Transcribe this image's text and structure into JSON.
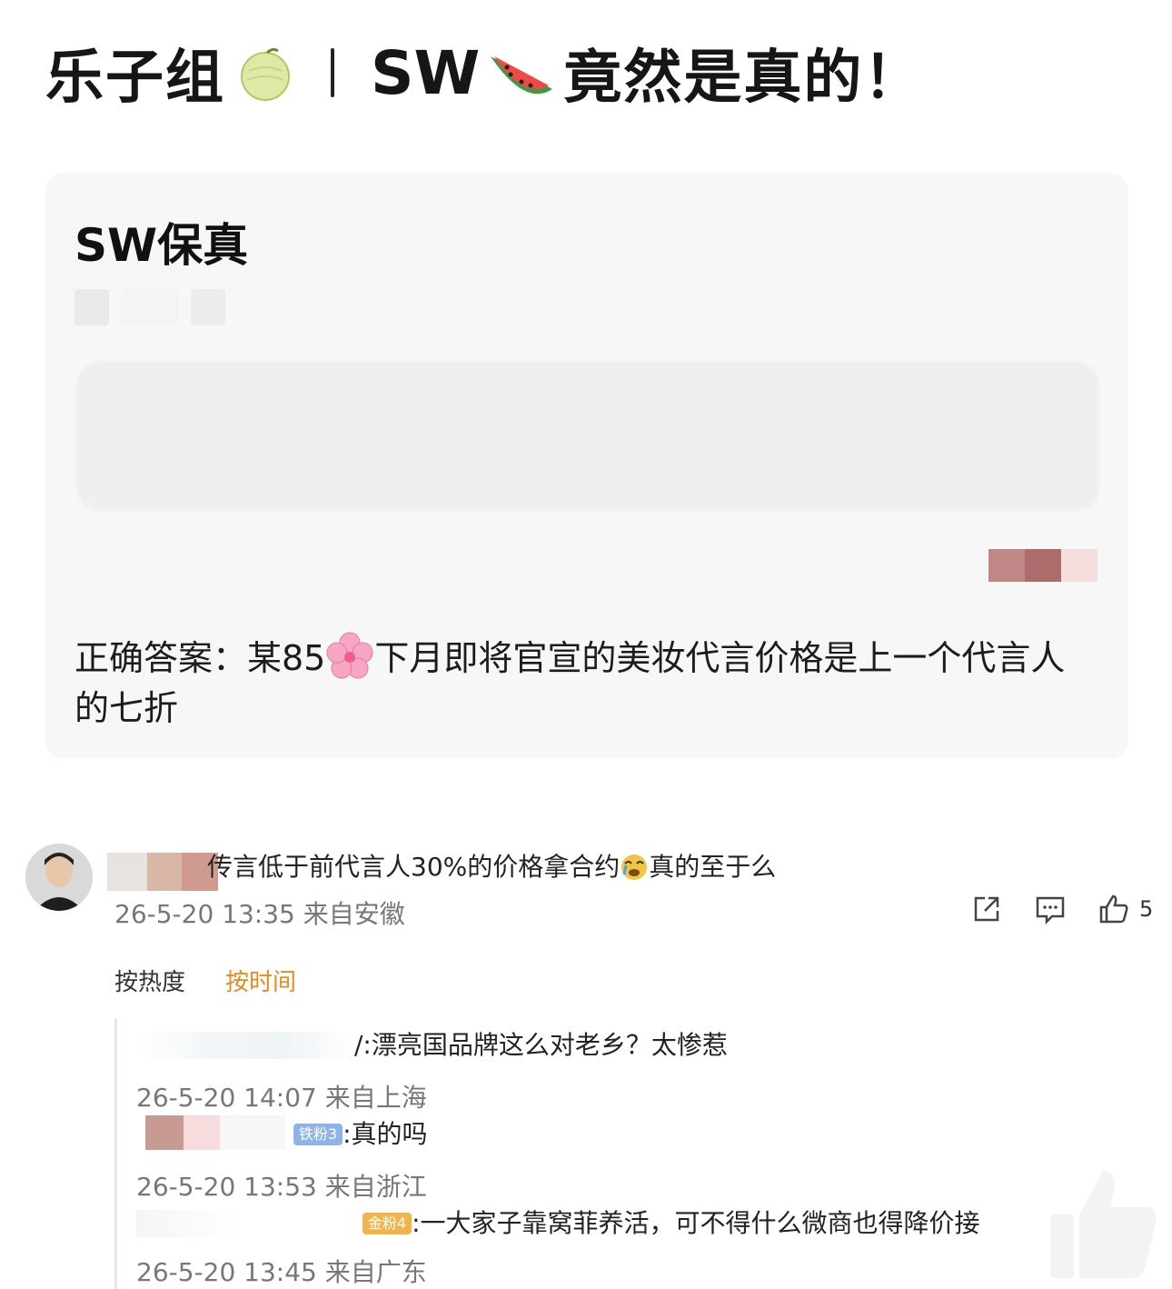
{
  "header": {
    "group_name": "乐子组",
    "headline_prefix": "SW",
    "headline_rest": "竟然是真的！"
  },
  "card": {
    "title": "SW保真",
    "answer_text_a": "正确答案：某85",
    "answer_text_b": "下月即将官宣的美妆代言价格是上一个代言人的七折"
  },
  "main_comment": {
    "text_a": "传言低于前代言人30%的价格拿合约",
    "text_b": "真的至于么",
    "time": "26-5-20 13:35 来自安徽",
    "like_count": "5"
  },
  "sort_tabs": {
    "hot": "按热度",
    "time": "按时间"
  },
  "replies": [
    {
      "text": "/:漂亮国品牌这么对老乡？太惨惹",
      "meta": "26-5-20 14:07 来自上海",
      "badge": ""
    },
    {
      "text": ":真的吗",
      "meta": "26-5-20 13:53 来自浙江",
      "badge": "铁粉3"
    },
    {
      "text": ":一大家子靠窝菲养活，可不得什么微商也得降价接",
      "meta": "26-5-20 13:45 来自广东",
      "badge": "金粉4"
    }
  ],
  "colors": {
    "accent_sort": "#e58a1f",
    "card_bg": "#f7f7f7",
    "meta_gray": "#777777"
  },
  "icons": {
    "melon": "melon-emoji-icon",
    "watermelon": "watermelon-emoji-icon",
    "flower": "cherry-blossom-emoji-icon",
    "share": "share-icon",
    "comment": "comment-icon",
    "like": "thumbs-up-icon"
  }
}
